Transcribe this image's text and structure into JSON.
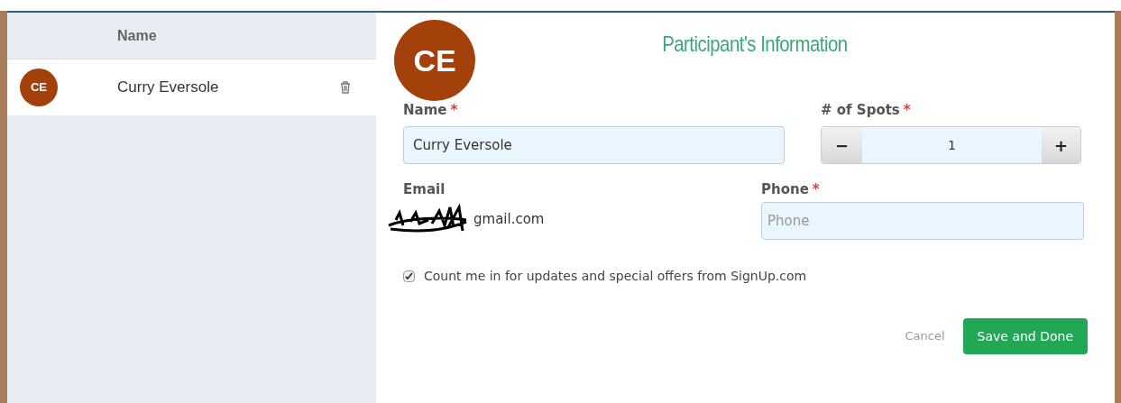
{
  "list": {
    "column": "Name",
    "rows": [
      {
        "initials": "CE",
        "name": "Curry Eversole",
        "selected": true
      }
    ]
  },
  "form": {
    "initials": "CE",
    "title": "Participant's Information",
    "name": {
      "label": "Name",
      "required": "*",
      "value": "Curry Eversole"
    },
    "spots": {
      "label": "# of Spots",
      "required": "*",
      "minus": "−",
      "value": "1",
      "plus": "+"
    },
    "email": {
      "label": "Email",
      "value": "gmail.com"
    },
    "phone": {
      "label": "Phone",
      "required": "*",
      "placeholder": "Phone"
    },
    "optin": {
      "label": "Count me in for updates and special offers from SignUp.com",
      "checked": true
    },
    "cancel": "Cancel",
    "save": "Save and Done"
  }
}
